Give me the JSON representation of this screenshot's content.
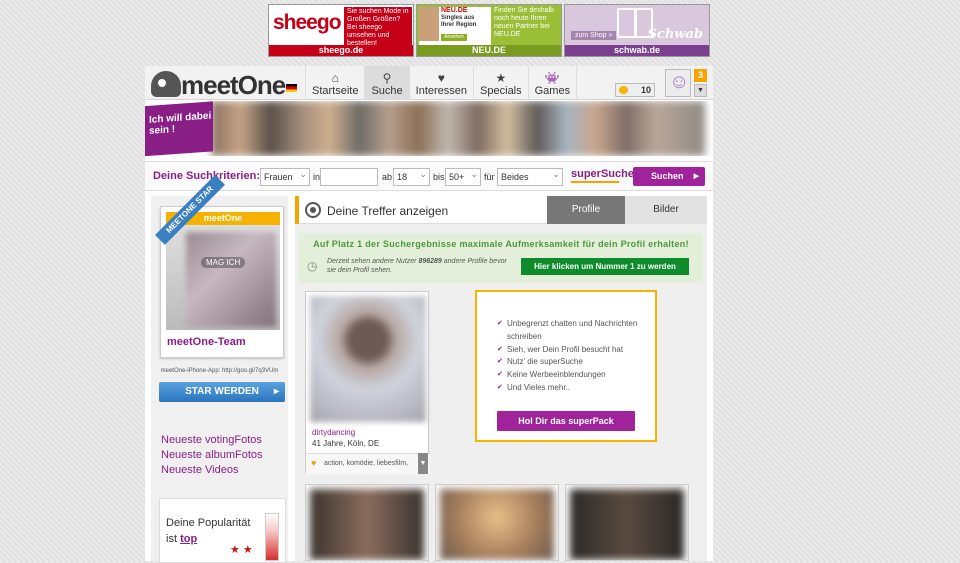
{
  "ads": [
    {
      "logo": "sheego",
      "text": "Sie suchen Mode in Großen Größen? Bei sheego umsehen und bestellen!",
      "footer": "sheego.de"
    },
    {
      "logo": "NEU.DE",
      "left_text": "Singles aus Ihrer Region",
      "cta": "Ansehen",
      "text": "Finden Sie deshalb noch heute Ihren neuen Partner bei NEU.DE",
      "footer": "NEU.DE"
    },
    {
      "logo": "Schwab",
      "shop": "zum Shop »",
      "footer": "schwab.de"
    }
  ],
  "header": {
    "logo": "meetOne",
    "nav": [
      {
        "icon": "home-icon",
        "glyph": "⌂",
        "label": "Startseite"
      },
      {
        "icon": "location-icon",
        "glyph": "⚲",
        "label": "Suche"
      },
      {
        "icon": "heart-icon",
        "glyph": "♥",
        "label": "Interessen"
      },
      {
        "icon": "star-icon",
        "glyph": "★",
        "label": "Specials"
      },
      {
        "icon": "game-icon",
        "glyph": "👾",
        "label": "Games"
      }
    ],
    "coins": "10",
    "notifications": "3"
  },
  "banner": {
    "cta": "Ich will dabei sein !"
  },
  "search": {
    "label": "Deine Suchkriterien:",
    "gender": "Frauen",
    "in_label": "in",
    "location": "",
    "ab_label": "ab",
    "age_from": "18",
    "bis_label": "bis",
    "age_to": "50+",
    "fuer_label": "für",
    "purpose": "Beides",
    "super": "superSuche",
    "button": "Suchen"
  },
  "left": {
    "phone_title": "meetOne",
    "phone_overlay": "MAG ICH",
    "ribbon": "MEETONE STAR",
    "team": "meetOne-Team",
    "app_link": "meetOne-iPhone-App: http://goo.gl/7q3VUm",
    "star_button": "STAR WERDEN",
    "links": [
      "Neueste votingFotos",
      "Neueste albumFotos",
      "Neueste Videos"
    ],
    "popularity_prefix": "Deine Popularität",
    "popularity_ist": "ist",
    "popularity_value": "top"
  },
  "content": {
    "treffer_title": "Deine Treffer anzeigen",
    "tab_profile": "Profile",
    "tab_bilder": "Bilder",
    "promo_head": "Auf Platz 1 der Suchergebnisse maximale Aufmerksamkeit für dein Profil erhalten!",
    "promo_sub_before": "Derzeit sehen andere Nutzer",
    "promo_number": "896289",
    "promo_sub_after": "andere Profile bevor sie dein Profil sehen.",
    "promo_button": "Hier klicken um Nummer 1 zu werden",
    "profile": {
      "name": "dirtydancing",
      "age_city": "41 Jahre, Köln, DE",
      "tags": "action, komödie, liebesfilm,"
    },
    "upsell": {
      "items": [
        "Unbegrenzt chatten und Nachrichten schreiben",
        "Sieh, wer Dein Profil besucht hat",
        "Nutz' die superSuche",
        "Keine Werbeeinblendungen",
        "Und Vieles mehr.."
      ],
      "button": "Hol Dir das superPack"
    }
  }
}
